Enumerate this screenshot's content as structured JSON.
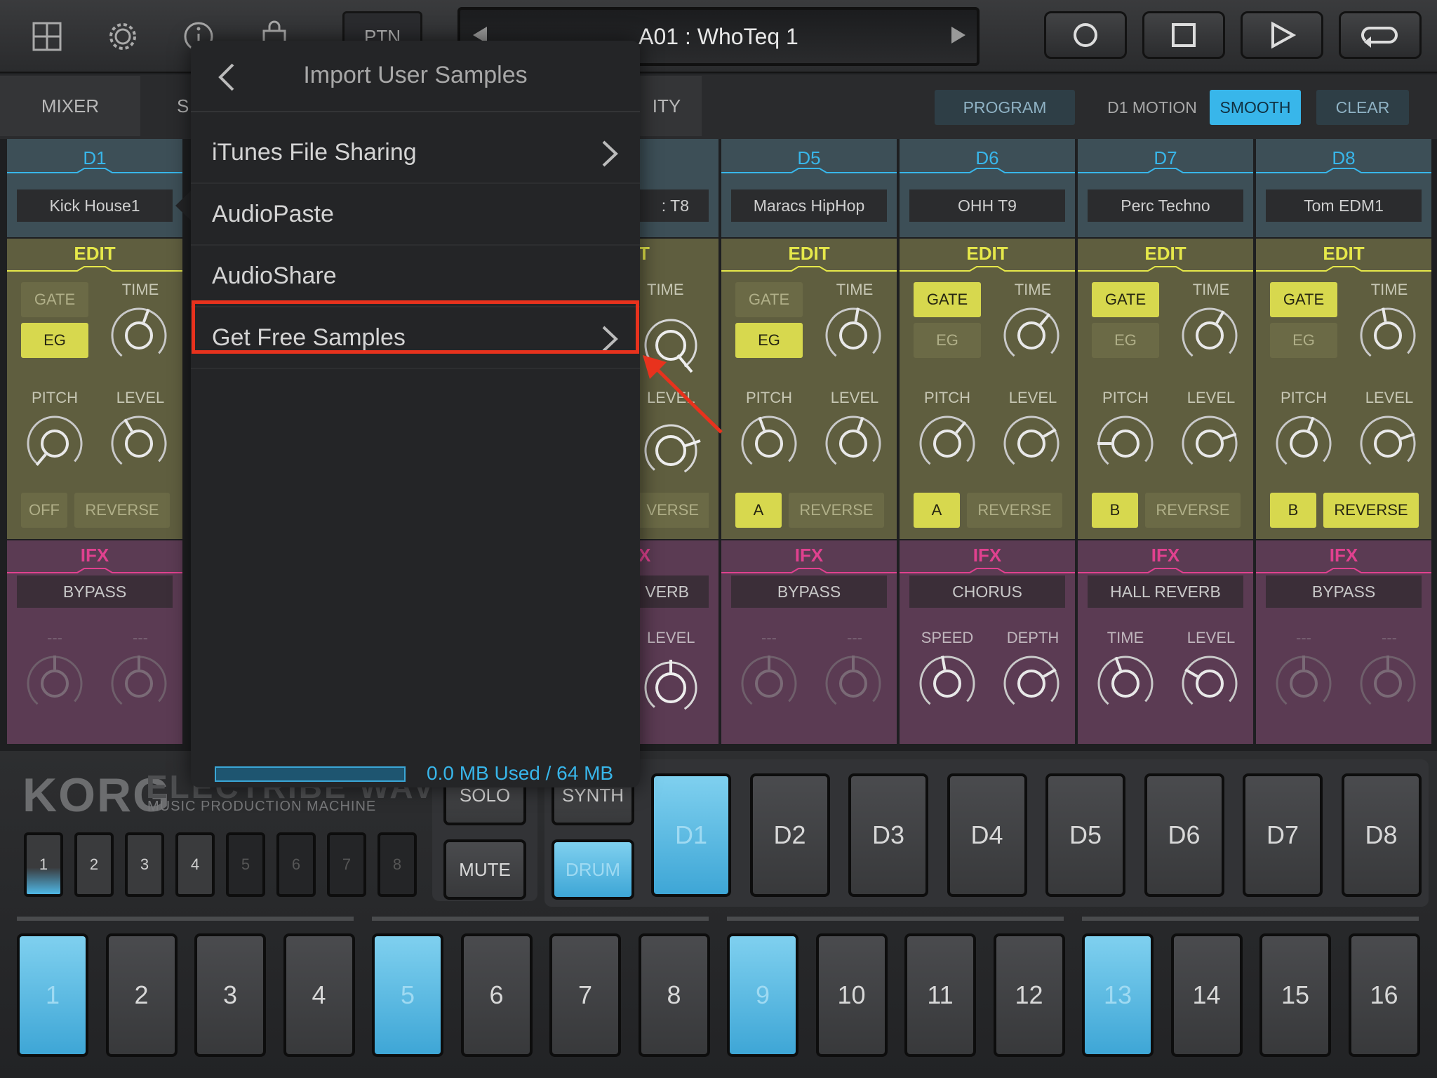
{
  "toolbar": {
    "ptn_label": "PTN",
    "pattern_name": "A01 : WhoTeq 1"
  },
  "tabs": {
    "mixer": "MIXER",
    "s_partial": "S",
    "ity_partial": "ITY"
  },
  "right_buttons": {
    "program": "PROGRAM",
    "d1_motion": "D1 MOTION",
    "smooth": "SMOOTH",
    "clear": "CLEAR"
  },
  "labels": {
    "edit": "EDIT",
    "ifx": "IFX",
    "gate": "GATE",
    "eg": "EG",
    "time": "TIME",
    "pitch": "PITCH",
    "level": "LEVEL",
    "reverse": "REVERSE",
    "off": "OFF",
    "speed": "SPEED",
    "depth": "DEPTH",
    "dash": "---",
    "verse_partial": "VERSE",
    "verb_partial": "VERB",
    "t_partial": "T",
    "x_partial": "X",
    "t8_partial": ": T8"
  },
  "channels": [
    {
      "name": "D1",
      "sample": "Kick House1",
      "gate_on": false,
      "eg_on": true,
      "mode": "OFF",
      "mode_on": false,
      "reverse_on": false,
      "ifx": "BYPASS",
      "ifx_active": false
    },
    {
      "name": "D5",
      "sample": "Maracs HipHop",
      "gate_on": false,
      "eg_on": true,
      "mode": "A",
      "mode_on": true,
      "reverse_on": false,
      "ifx": "BYPASS",
      "ifx_active": false
    },
    {
      "name": "D6",
      "sample": "OHH T9",
      "gate_on": true,
      "eg_on": false,
      "mode": "A",
      "mode_on": true,
      "reverse_on": false,
      "ifx": "CHORUS",
      "ifx_active": true,
      "ifx_p1": "SPEED",
      "ifx_p2": "DEPTH"
    },
    {
      "name": "D7",
      "sample": "Perc Techno",
      "gate_on": true,
      "eg_on": false,
      "mode": "B",
      "mode_on": true,
      "reverse_on": false,
      "ifx": "HALL REVERB",
      "ifx_active": true,
      "ifx_p1": "TIME",
      "ifx_p2": "LEVEL"
    },
    {
      "name": "D8",
      "sample": "Tom EDM1",
      "gate_on": true,
      "eg_on": false,
      "mode": "B",
      "mode_on": true,
      "reverse_on": true,
      "ifx": "BYPASS",
      "ifx_active": false
    }
  ],
  "brand": {
    "logo": "KORG",
    "product": "ELECTRIBE WAVE",
    "tagline": "MUSIC PRODUCTION MACHINE"
  },
  "part_buttons": [
    "1",
    "2",
    "3",
    "4",
    "5",
    "6",
    "7",
    "8"
  ],
  "controls": {
    "solo": "SOLO",
    "mute": "MUTE",
    "synth": "SYNTH",
    "drum": "DRUM"
  },
  "drum_pads": [
    "D1",
    "D2",
    "D3",
    "D4",
    "D5",
    "D6",
    "D7",
    "D8"
  ],
  "step_pads": [
    "1",
    "2",
    "3",
    "4",
    "5",
    "6",
    "7",
    "8",
    "9",
    "10",
    "11",
    "12",
    "13",
    "14",
    "15",
    "16"
  ],
  "popup": {
    "title": "Import User Samples",
    "items": [
      "iTunes File Sharing",
      "AudioPaste",
      "AudioShare",
      "Get Free Samples"
    ],
    "storage": "0.0 MB Used / 64 MB"
  },
  "colors": {
    "accent": "#38b6ea",
    "edit": "#e6e84a",
    "ifx": "#e0418f",
    "highlight": "#e8321d"
  }
}
